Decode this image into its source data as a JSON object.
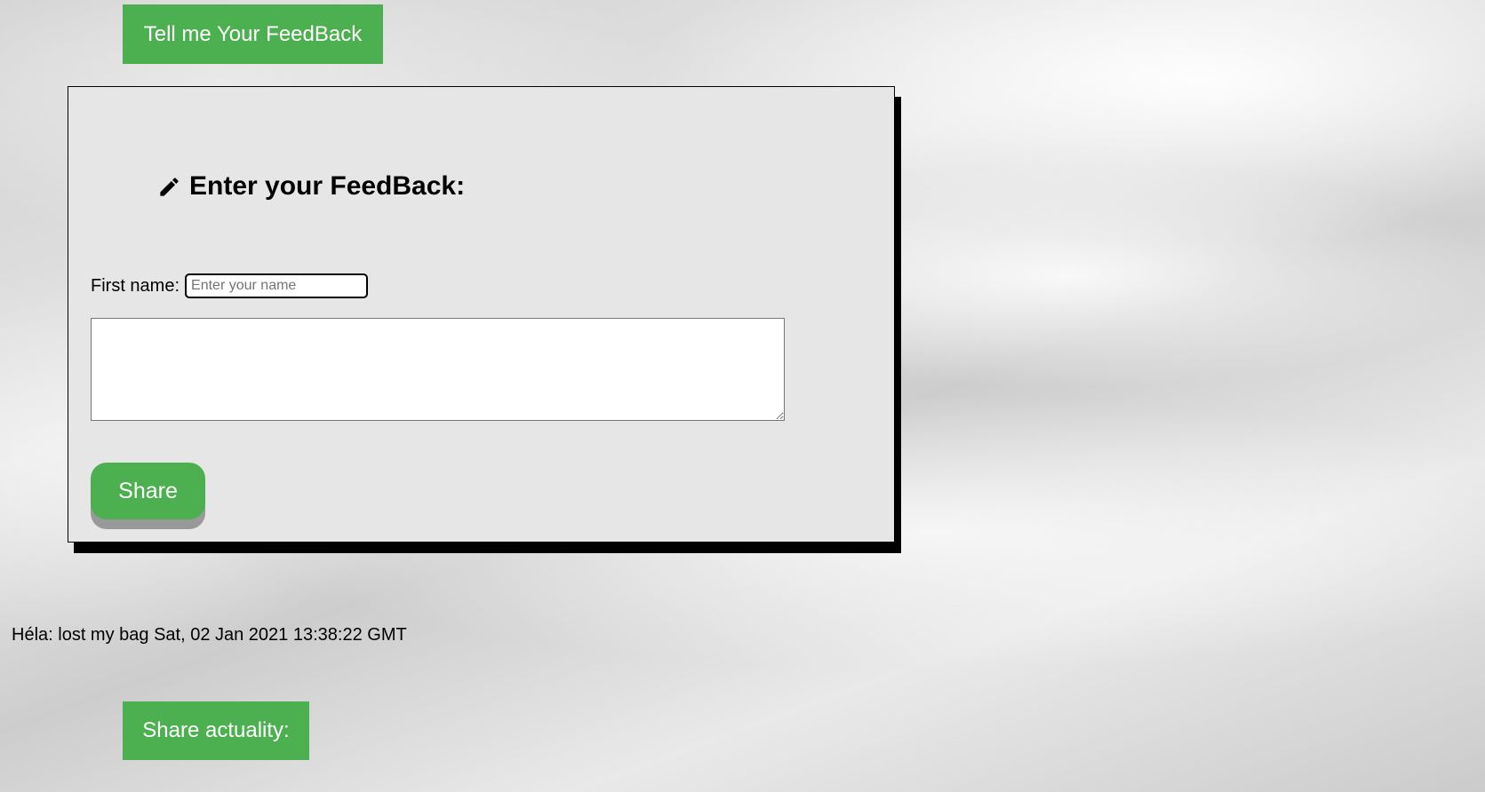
{
  "header": {
    "feedback_button_label": "Tell me Your FeedBack"
  },
  "form": {
    "title": "Enter your FeedBack:",
    "title_icon": "pencil-icon",
    "first_name_label": "First name:",
    "first_name_placeholder": "Enter your name",
    "first_name_value": "",
    "feedback_value": "",
    "share_button_label": "Share"
  },
  "feed": {
    "messages": [
      {
        "text": "Héla: lost my bag Sat, 02 Jan 2021 13:38:22 GMT"
      }
    ]
  },
  "footer": {
    "share_actuality_label": "Share actuality:"
  },
  "colors": {
    "accent_green": "#4caf50",
    "panel_background": "#e6e6e6",
    "panel_shadow": "#000000",
    "share_shadow": "#999999"
  }
}
